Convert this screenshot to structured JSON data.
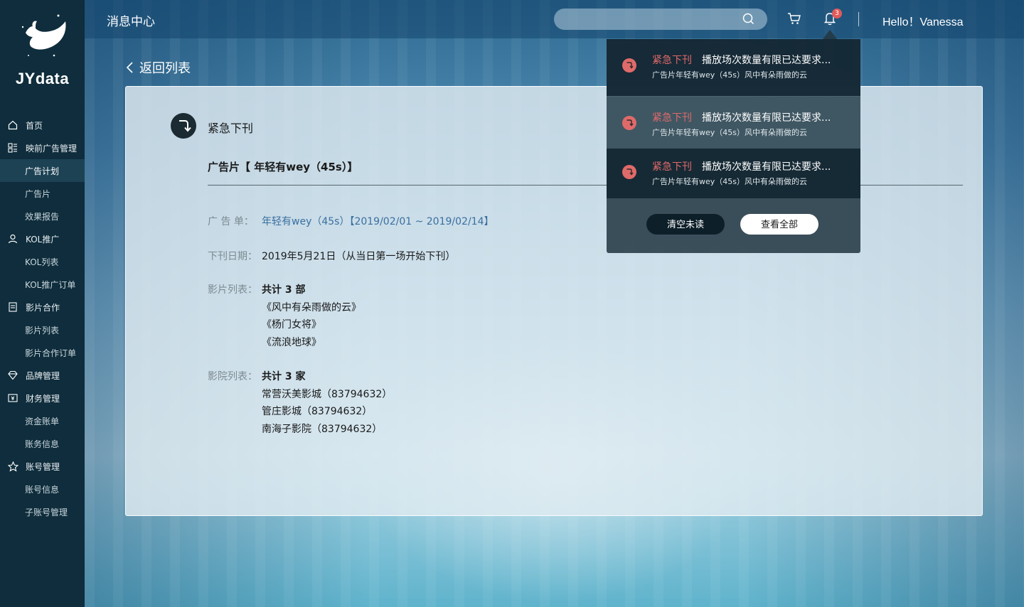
{
  "app": {
    "logo_text": "JYdata"
  },
  "sidebar": {
    "items": [
      {
        "label": "首页",
        "icon": "home-icon"
      },
      {
        "label": "映前广告管理",
        "icon": "grid-icon"
      },
      {
        "label": "广告计划"
      },
      {
        "label": "广告片"
      },
      {
        "label": "效果报告"
      },
      {
        "label": "KOL推广",
        "icon": "user-icon"
      },
      {
        "label": "KOL列表"
      },
      {
        "label": "KOL推广订单"
      },
      {
        "label": "影片合作",
        "icon": "document-icon"
      },
      {
        "label": "影片列表"
      },
      {
        "label": "影片合作订单"
      },
      {
        "label": "品牌管理",
        "icon": "diamond-icon"
      },
      {
        "label": "财务管理",
        "icon": "finance-icon"
      },
      {
        "label": "资金账单"
      },
      {
        "label": "账务信息"
      },
      {
        "label": "账号管理",
        "icon": "star-icon"
      },
      {
        "label": "账号信息"
      },
      {
        "label": "子账号管理"
      }
    ],
    "active_index": 2
  },
  "header": {
    "title": "消息中心",
    "search_placeholder": "",
    "notification_count": "3",
    "greeting": "Hello！Vanessa"
  },
  "back_link": "返回列表",
  "message": {
    "type": "紧急下刊",
    "headline": "广告片【 年轻有wey（45s）】",
    "fields": {
      "order_label": "广 告 单：",
      "order_value": "年轻有wey（45s）【2019/02/01 ~ 2019/02/14】",
      "date_label": "下刊日期：",
      "date_value": "2019年5月21日（从当日第一场开始下刊）",
      "films_label": "影片列表：",
      "films_total": "共计 3 部",
      "films": [
        "《风中有朵雨做的云》",
        "《杨门女将》",
        "《流浪地球》"
      ],
      "cinemas_label": "影院列表：",
      "cinemas_total": "共计 3 家",
      "cinemas": [
        "常营沃美影城（83794632）",
        "管庄影城（83794632）",
        "南海子影院（83794632）"
      ]
    }
  },
  "notifications": {
    "items": [
      {
        "tag": "紧急下刊",
        "title": "播放场次数量有限已达要求...",
        "subtitle": "广告片年轻有wey（45s）风中有朵雨做的云"
      },
      {
        "tag": "紧急下刊",
        "title": "播放场次数量有限已达要求...",
        "subtitle": "广告片年轻有wey（45s）风中有朵雨做的云"
      },
      {
        "tag": "紧急下刊",
        "title": "播放场次数量有限已达要求...",
        "subtitle": "广告片年轻有wey（45s）风中有朵雨做的云"
      }
    ],
    "clear_label": "清空未读",
    "view_all_label": "查看全部"
  },
  "colors": {
    "sidebar_bg": "#0f2d3c",
    "accent_red": "#e06a6a",
    "link_blue": "#3a6fa0"
  }
}
